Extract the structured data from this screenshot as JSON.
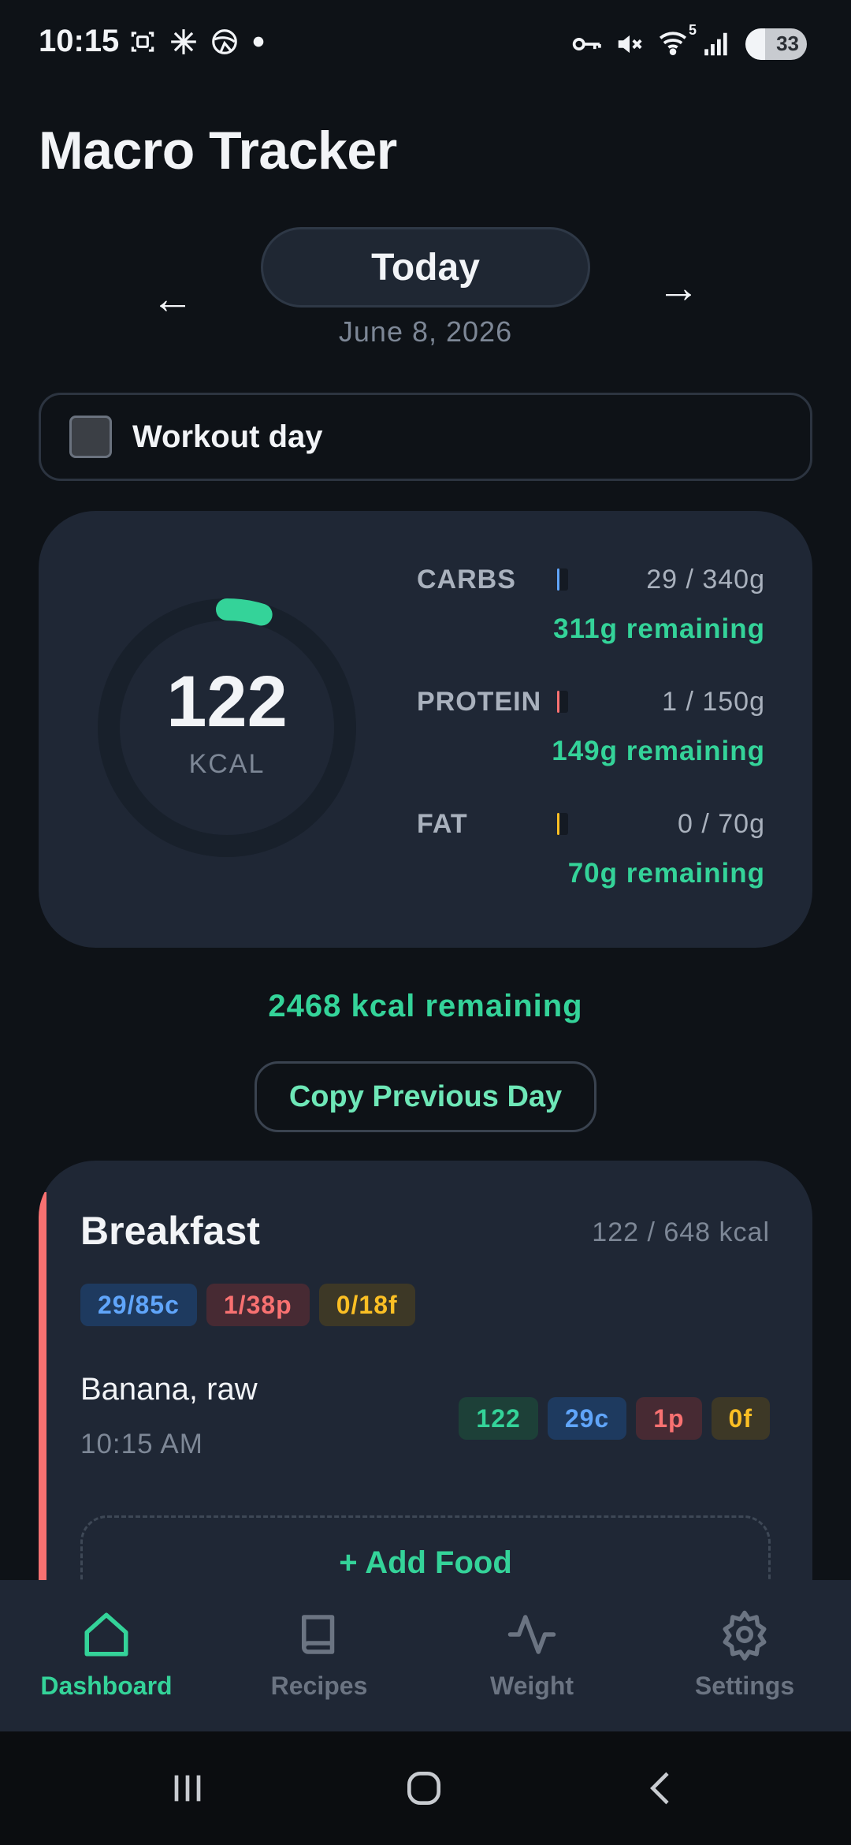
{
  "status_bar": {
    "time": "10:15",
    "left_icons": [
      "screenshot-icon",
      "pinwheel-icon",
      "steering-icon",
      "dot-icon"
    ],
    "right_icons": [
      "key-icon",
      "mute-icon",
      "wifi-icon",
      "signal-icon"
    ],
    "wifi_badge": "5",
    "battery": "33"
  },
  "header": {
    "title": "Macro Tracker"
  },
  "date_nav": {
    "prev_icon": "←",
    "next_icon": "→",
    "label": "Today",
    "date": "June 8, 2026"
  },
  "workout": {
    "label": "Workout day",
    "checked": false
  },
  "summary": {
    "kcal_value": "122",
    "kcal_unit": "KCAL",
    "kcal_progress": 0.047,
    "macros": [
      {
        "name": "CARBS",
        "amount": "29 / 340g",
        "remaining": "311g remaining",
        "color": "#60a5fa"
      },
      {
        "name": "PROTEIN",
        "amount": "1 / 150g",
        "remaining": "149g remaining",
        "color": "#f87171"
      },
      {
        "name": "FAT",
        "amount": "0 / 70g",
        "remaining": "70g remaining",
        "color": "#fbbf24"
      }
    ]
  },
  "kcal_remaining": "2468 kcal remaining",
  "copy_button": "Copy Previous Day",
  "meal": {
    "title": "Breakfast",
    "kcal": "122 / 648 kcal",
    "chips": [
      "29/85c",
      "1/38p",
      "0/18f"
    ],
    "food": {
      "name": "Banana, raw",
      "time": "10:15 AM",
      "chips": [
        "122",
        "29c",
        "1p",
        "0f"
      ]
    },
    "add_label": "+ Add Food"
  },
  "bottom_nav": [
    {
      "label": "Dashboard",
      "icon": "home-icon"
    },
    {
      "label": "Recipes",
      "icon": "book-icon"
    },
    {
      "label": "Weight",
      "icon": "activity-icon"
    },
    {
      "label": "Settings",
      "icon": "gear-icon"
    }
  ],
  "colors": {
    "accent": "#34d399",
    "background": "#0e1217",
    "card": "#1f2735"
  }
}
